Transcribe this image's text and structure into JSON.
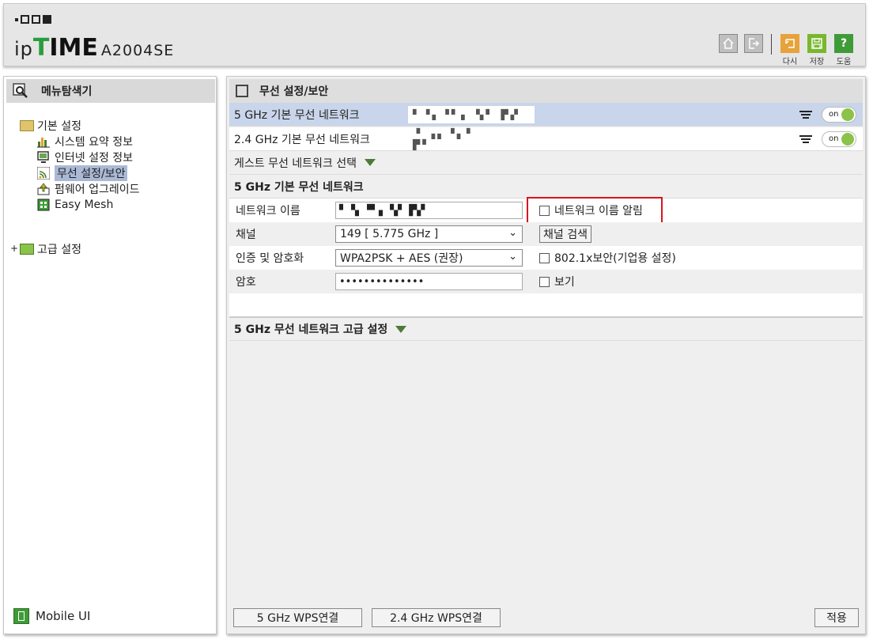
{
  "header": {
    "brand_prefix": "ip",
    "brand_time": "TIME",
    "model": "A2004SE",
    "icons": [
      "home-icon",
      "logout-icon"
    ],
    "actions": [
      {
        "label": "다시",
        "icon": "undo-icon",
        "color": "#e8a23a"
      },
      {
        "label": "저장",
        "icon": "save-icon",
        "color": "#79b72e"
      },
      {
        "label": "도움",
        "icon": "help-icon",
        "color": "#3f9b37"
      }
    ]
  },
  "sidebar": {
    "title": "메뉴탐색기",
    "basic": {
      "label": "기본 설정",
      "items": [
        {
          "label": "시스템 요약 정보",
          "icon": "chart-icon"
        },
        {
          "label": "인터넷 설정 정보",
          "icon": "monitor-icon"
        },
        {
          "label": "무선 설정/보안",
          "icon": "wifi-icon",
          "selected": true
        },
        {
          "label": "펌웨어 업그레이드",
          "icon": "upload-icon"
        },
        {
          "label": "Easy Mesh",
          "icon": "mesh-icon"
        }
      ]
    },
    "advanced": {
      "label": "고급 설정",
      "expander": "+"
    },
    "mobile_ui": "Mobile UI"
  },
  "main": {
    "title": "무선 설정/보안",
    "networks": [
      {
        "label": "5 GHz 기본 무선 네트워크",
        "ssid": "▘▝▖▝▘▖ ▚▘ ▛▞",
        "toggle": "on"
      },
      {
        "label": "2.4 GHz 기본 무선 네트워크",
        "ssid": "▝  ▗▖▝▖▘ ▛▘",
        "toggle": "on"
      }
    ],
    "guest_select": "게스트 무선 네트워크 선택",
    "section_title": "5 GHz 기본 무선 네트워크",
    "form": {
      "network_name_label": "네트워크 이름",
      "network_name_value": "▘▝▖▝▘▖ ▚▘ ▛▞",
      "broadcast_label": "네트워크 이름 알림",
      "channel_label": "채널",
      "channel_value": "149 [ 5.775 GHz ]",
      "channel_scan": "채널 검색",
      "auth_label": "인증 및 암호화",
      "auth_value": "WPA2PSK + AES (권장)",
      "enterprise_label": "802.1x보안(기업용 설정)",
      "password_label": "암호",
      "password_value": "••••••••••••••",
      "show_label": "보기"
    },
    "advanced_title": "5 GHz 무선 네트워크 고급 설정",
    "buttons": {
      "wps5": "5 GHz WPS연결",
      "wps24": "2.4 GHz WPS연결",
      "apply": "적용"
    }
  }
}
